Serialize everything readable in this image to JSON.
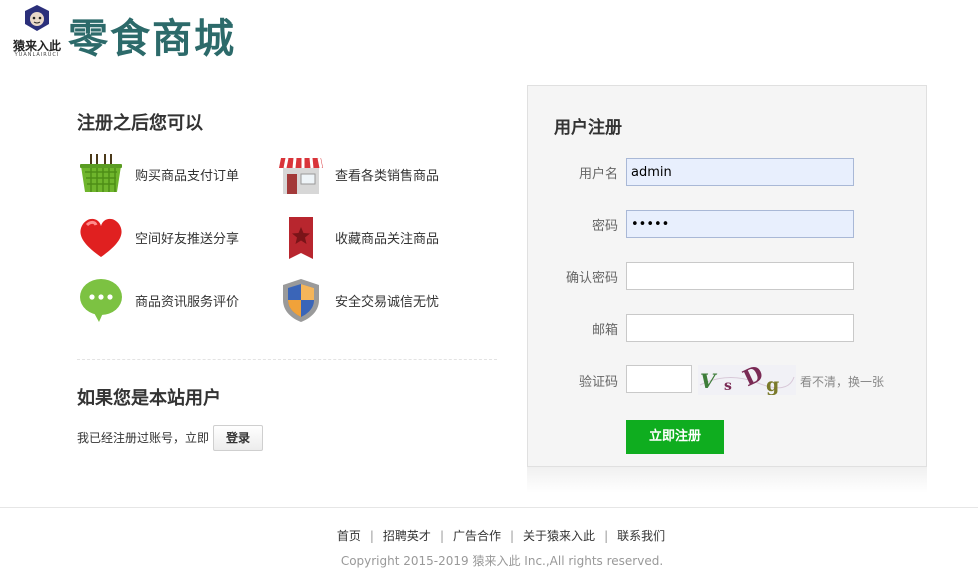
{
  "brand": {
    "logo_icon": "monkey-mascot-icon",
    "name": "猿来入此",
    "sub": "YUANLAIRUCI"
  },
  "site_title": "零食商城",
  "benefits": {
    "title": "注册之后您可以",
    "items": [
      {
        "label": "购买商品支付订单",
        "icon": "shopping-basket-icon"
      },
      {
        "label": "查看各类销售商品",
        "icon": "storefront-icon"
      },
      {
        "label": "空间好友推送分享",
        "icon": "heart-icon"
      },
      {
        "label": "收藏商品关注商品",
        "icon": "bookmark-star-icon"
      },
      {
        "label": "商品资讯服务评价",
        "icon": "chat-bubble-icon"
      },
      {
        "label": "安全交易诚信无忧",
        "icon": "shield-icon"
      }
    ]
  },
  "member": {
    "title": "如果您是本站用户",
    "text": "我已经注册过账号，立即",
    "login_button": "登录"
  },
  "register": {
    "title": "用户注册",
    "fields": {
      "username": {
        "label": "用户名",
        "value": "admin"
      },
      "password": {
        "label": "密码",
        "value": "•••••"
      },
      "confirm": {
        "label": "确认密码",
        "value": ""
      },
      "email": {
        "label": "邮箱",
        "value": ""
      },
      "captcha": {
        "label": "验证码",
        "value": ""
      }
    },
    "captcha_image": {
      "chars": [
        "V",
        "s",
        "D",
        "g"
      ],
      "colors": [
        "#3e7d3a",
        "#7a2a55",
        "#7a2a55",
        "#7a7a2a"
      ]
    },
    "refresh_text": "看不清，换一张",
    "submit_button": "立即注册"
  },
  "footer": {
    "links": [
      "首页",
      "招聘英才",
      "广告合作",
      "关于猿来入此",
      "联系我们"
    ],
    "copyright": "Copyright 2015-2019 猿来入此 Inc.,All rights reserved."
  },
  "colors": {
    "submit_green": "#0fad1f",
    "title_teal": "#2c6a6a",
    "autofill_bg": "#e8effd"
  }
}
